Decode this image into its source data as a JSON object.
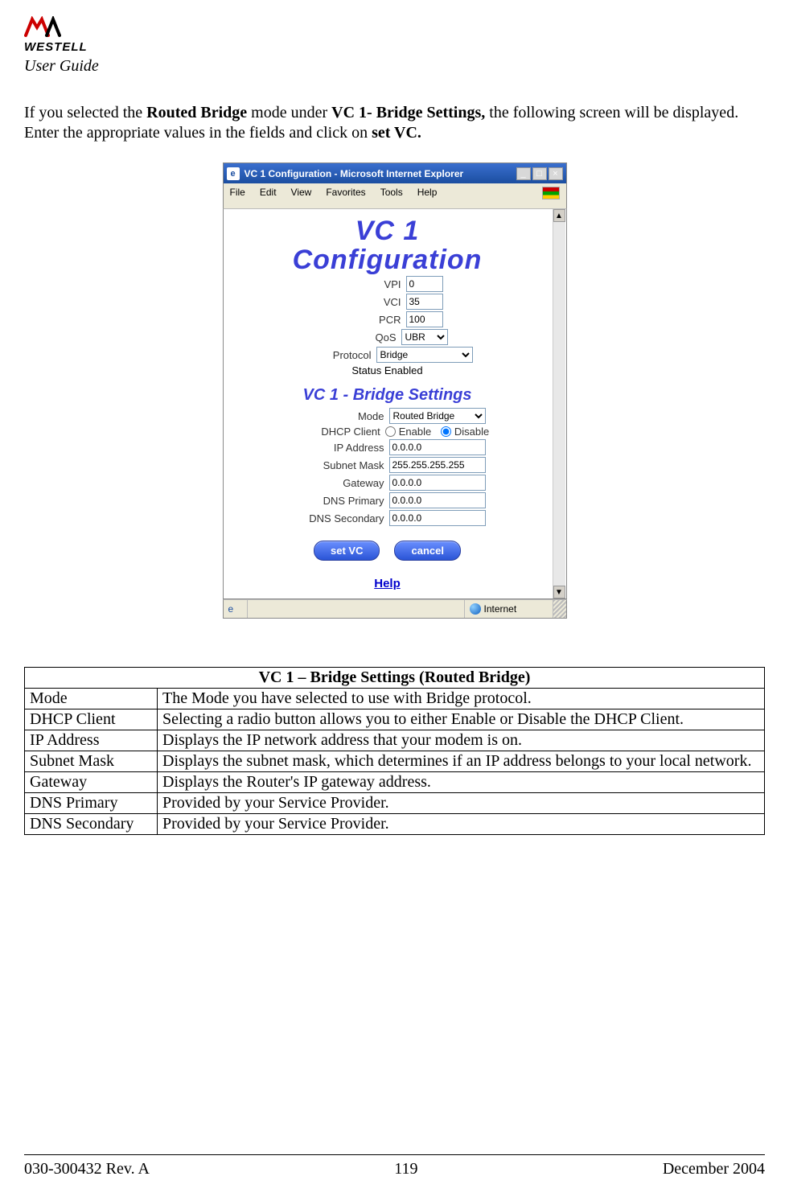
{
  "header": {
    "brand": "WESTELL",
    "user_guide": "User Guide"
  },
  "intro": {
    "pre": "If you selected the ",
    "b1": "Routed Bridge",
    "mid1": " mode under ",
    "b2": "VC 1- Bridge Settings,",
    "mid2": " the following screen will be displayed. Enter the appropriate values in the fields and click on ",
    "b3": "set VC."
  },
  "browser": {
    "title": "VC 1 Configuration - Microsoft Internet Explorer",
    "menus": [
      "File",
      "Edit",
      "View",
      "Favorites",
      "Tools",
      "Help"
    ],
    "status_zone": "Internet",
    "win_buttons": {
      "min": "_",
      "max": "□",
      "close": "×"
    },
    "scroll": {
      "up": "▲",
      "down": "▼"
    },
    "ie_glyph": "e",
    "ie_status_glyph": "e"
  },
  "config": {
    "title_line1": "VC 1",
    "title_line2": "Configuration",
    "fields": {
      "vpi_label": "VPI",
      "vpi": "0",
      "vci_label": "VCI",
      "vci": "35",
      "pcr_label": "PCR",
      "pcr": "100",
      "qos_label": "QoS",
      "qos": "UBR",
      "protocol_label": "Protocol",
      "protocol": "Bridge",
      "status_label": "Status",
      "status_value": "Enabled"
    },
    "bridge_title": "VC 1 - Bridge Settings",
    "bridge": {
      "mode_label": "Mode",
      "mode": "Routed Bridge",
      "dhcp_label": "DHCP Client",
      "dhcp_enable": "Enable",
      "dhcp_disable": "Disable",
      "dhcp_value": "Disable",
      "ip_label": "IP Address",
      "ip": "0.0.0.0",
      "mask_label": "Subnet Mask",
      "mask": "255.255.255.255",
      "gw_label": "Gateway",
      "gw": "0.0.0.0",
      "dns1_label": "DNS Primary",
      "dns1": "0.0.0.0",
      "dns2_label": "DNS Secondary",
      "dns2": "0.0.0.0"
    },
    "buttons": {
      "set": "set VC",
      "cancel": "cancel"
    },
    "help": "Help"
  },
  "table": {
    "caption": "VC 1 – Bridge Settings (Routed Bridge)",
    "rows": [
      {
        "k": "Mode",
        "v": "The Mode you have selected to use with Bridge protocol."
      },
      {
        "k": "DHCP Client",
        "v": "Selecting a radio button allows you to either Enable or Disable the DHCP Client."
      },
      {
        "k": "IP Address",
        "v": "Displays the IP network address that your modem is on."
      },
      {
        "k": "Subnet Mask",
        "v": "Displays the subnet mask, which determines if an IP address belongs to your local network."
      },
      {
        "k": "Gateway",
        "v": "Displays the Router's IP gateway address."
      },
      {
        "k": "DNS Primary",
        "v": "Provided by your Service Provider."
      },
      {
        "k": "DNS Secondary",
        "v": "Provided by your Service Provider."
      }
    ]
  },
  "footer": {
    "left": "030-300432 Rev. A",
    "center": "119",
    "right": "December 2004"
  }
}
